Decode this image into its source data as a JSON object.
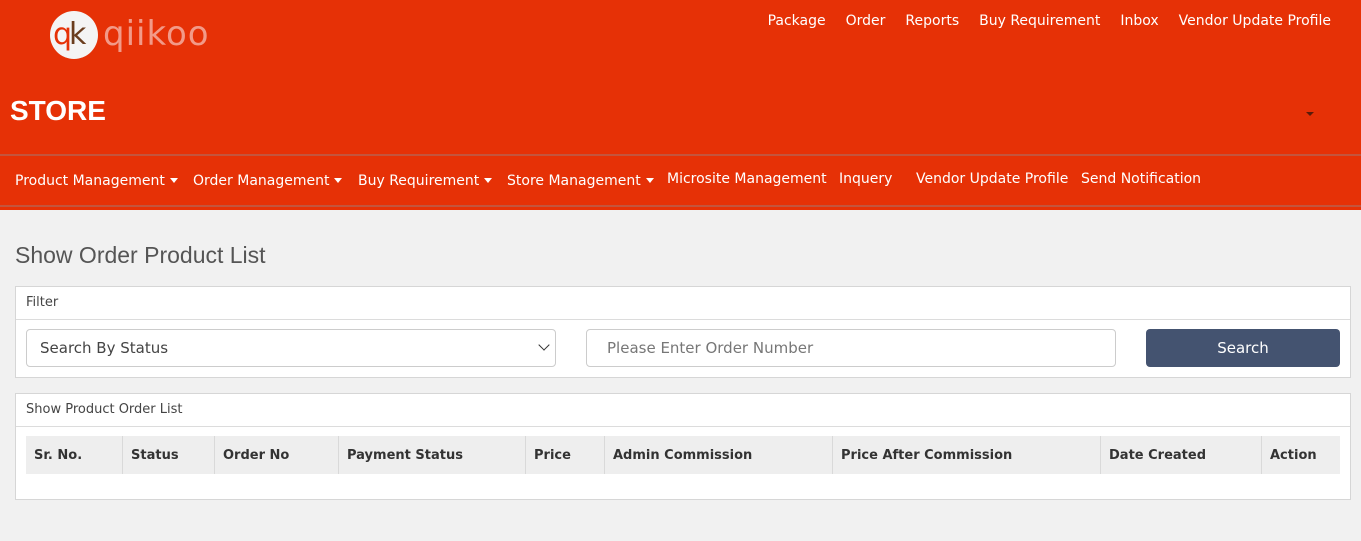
{
  "brand": {
    "logo_mark_a": "q",
    "logo_mark_b": "k",
    "logo_text": "qiikoo",
    "store_title": "STORE"
  },
  "top_nav": [
    "Package",
    "Order",
    "Reports",
    "Buy Requirement",
    "Inbox",
    "Vendor Update Profile"
  ],
  "main_nav": [
    {
      "label": "Product Management",
      "dropdown": true
    },
    {
      "label": "Order Management",
      "dropdown": true
    },
    {
      "label": "Buy Requirement",
      "dropdown": true
    },
    {
      "label": "Store Management",
      "dropdown": true
    },
    {
      "label": "Microsite Management",
      "dropdown": false
    },
    {
      "label": "Inquery",
      "dropdown": false
    },
    {
      "label": "Vendor Update Profile",
      "dropdown": false
    },
    {
      "label": "Send Notification",
      "dropdown": false
    }
  ],
  "page": {
    "title": "Show Order Product List"
  },
  "filter": {
    "title": "Filter",
    "status_select": "Search By Status",
    "order_placeholder": "Please Enter Order Number",
    "search_label": "Search"
  },
  "list": {
    "title": "Show Product Order List",
    "columns": [
      "Sr. No.",
      "Status",
      "Order No",
      "Payment Status",
      "Price",
      "Admin Commission",
      "Price After Commission",
      "Date Created",
      "Action"
    ]
  },
  "colors": {
    "brand_red": "#e63106",
    "search_button": "#445370",
    "background": "#f1f1f1"
  }
}
